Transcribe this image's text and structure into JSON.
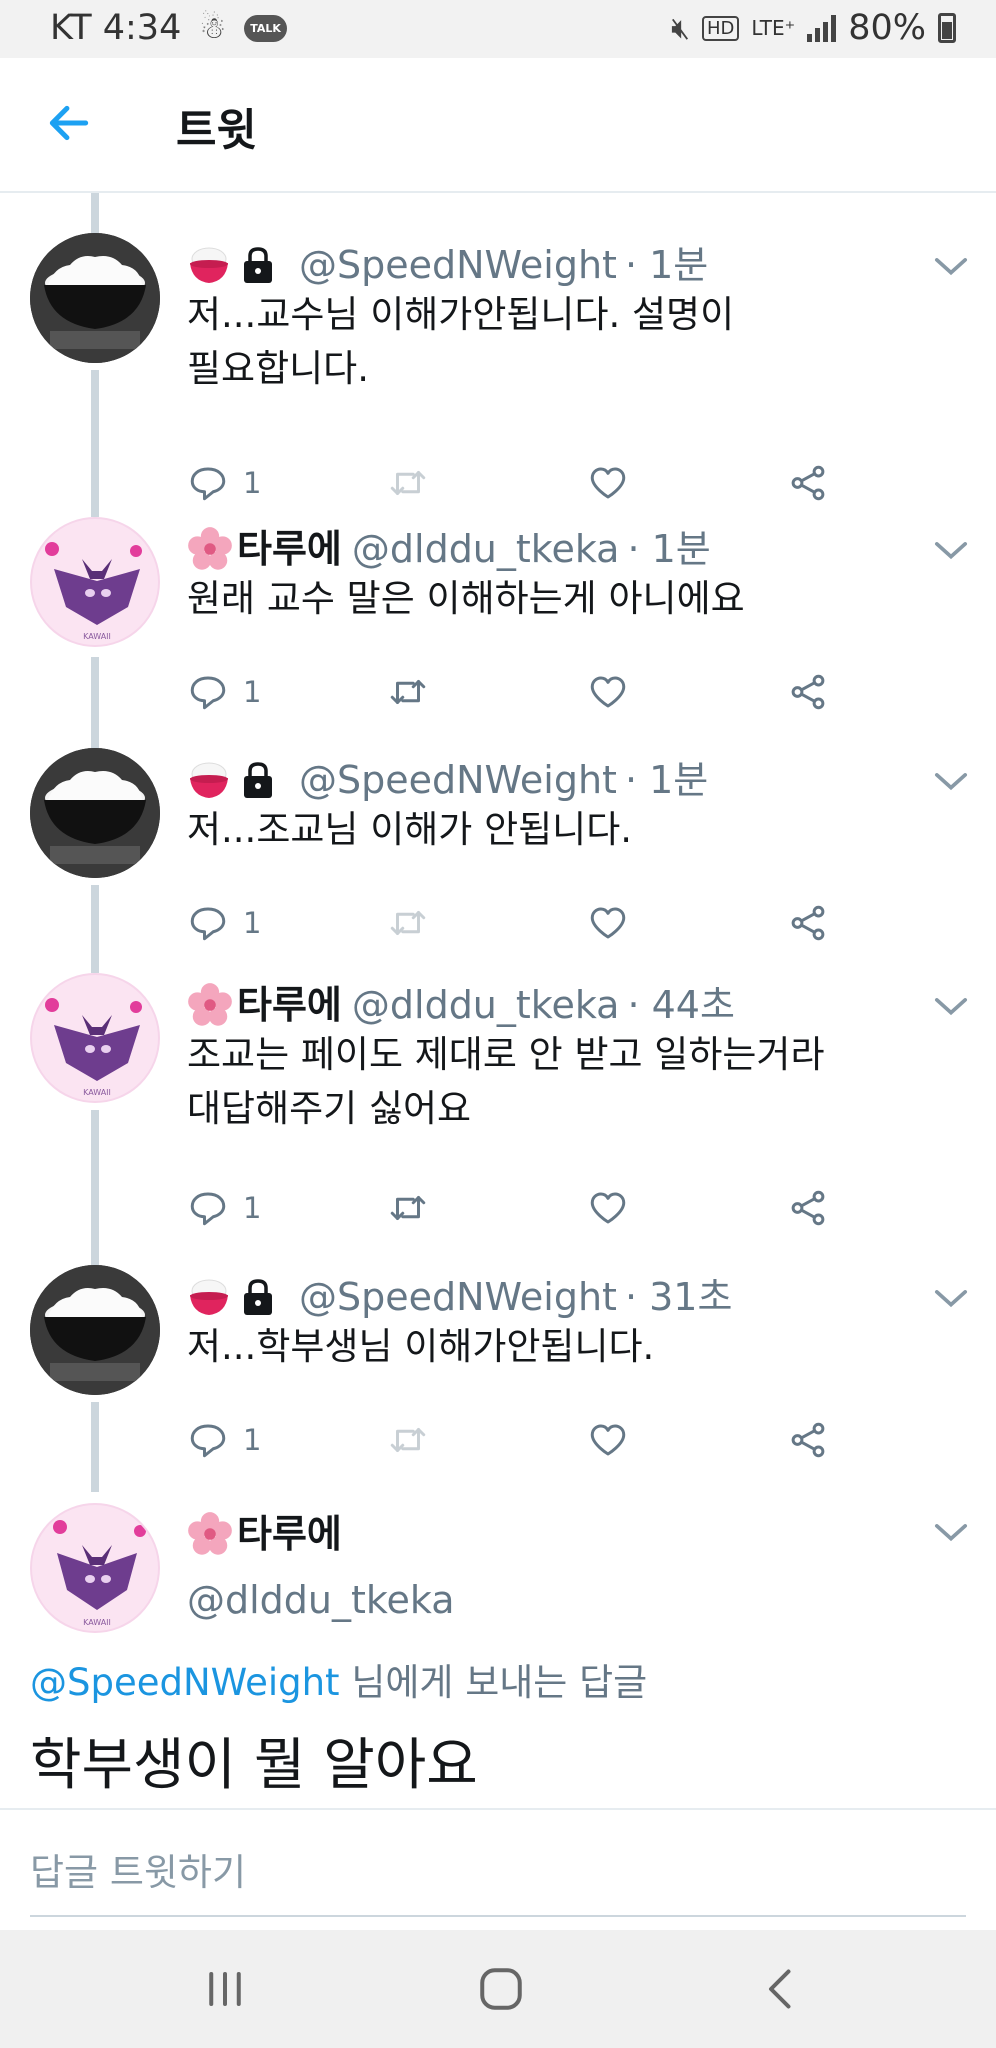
{
  "status_bar": {
    "carrier_time": "KT 4:34",
    "talk_badge": "TALK",
    "hd": "HD",
    "lte": "LTE⁺",
    "battery": "80%"
  },
  "header": {
    "title": "트윗"
  },
  "tweets": [
    {
      "display_name": "",
      "handle": "@SpeedNWeight",
      "time": "· 1분",
      "text": "저...교수님 이해가안됩니다. 설명이\n필요합니다.",
      "reply_count": "1",
      "retweet_enabled": false
    },
    {
      "display_name": "타루에",
      "handle": "@dlddu_tkeka",
      "time": "· 1분",
      "text": "원래 교수 말은 이해하는게 아니에요",
      "reply_count": "1",
      "retweet_enabled": true
    },
    {
      "display_name": "",
      "handle": "@SpeedNWeight",
      "time": "· 1분",
      "text": "저...조교님 이해가 안됩니다.",
      "reply_count": "1",
      "retweet_enabled": false
    },
    {
      "display_name": "타루에",
      "handle": "@dlddu_tkeka",
      "time": "· 44초",
      "text": "조교는 페이도 제대로 안 받고 일하는거라\n대답해주기 싫어요",
      "reply_count": "1",
      "retweet_enabled": true
    },
    {
      "display_name": "",
      "handle": "@SpeedNWeight",
      "time": "· 31초",
      "text": "저...학부생님 이해가안됩니다.",
      "reply_count": "1",
      "retweet_enabled": false
    }
  ],
  "focused_tweet": {
    "display_name": "타루에",
    "handle": "@dlddu_tkeka",
    "reply_to_mention": "@SpeedNWeight",
    "reply_to_suffix": " 님에게 보내는 답글",
    "text": "학부생이 뭘 알아요"
  },
  "compose": {
    "placeholder": "답글 트윗하기"
  },
  "avatar_text": "KAWAII",
  "colors": {
    "accent": "#1da1f2",
    "mention": "#1b95e0",
    "secondary": "#657786",
    "thread_line": "#ccd6dd"
  },
  "icons": [
    "back-arrow-icon",
    "caret-down-icon",
    "reply-icon",
    "retweet-icon",
    "like-icon",
    "share-icon",
    "lock-icon",
    "rice-bowl-icon",
    "cherry-blossom-icon"
  ]
}
